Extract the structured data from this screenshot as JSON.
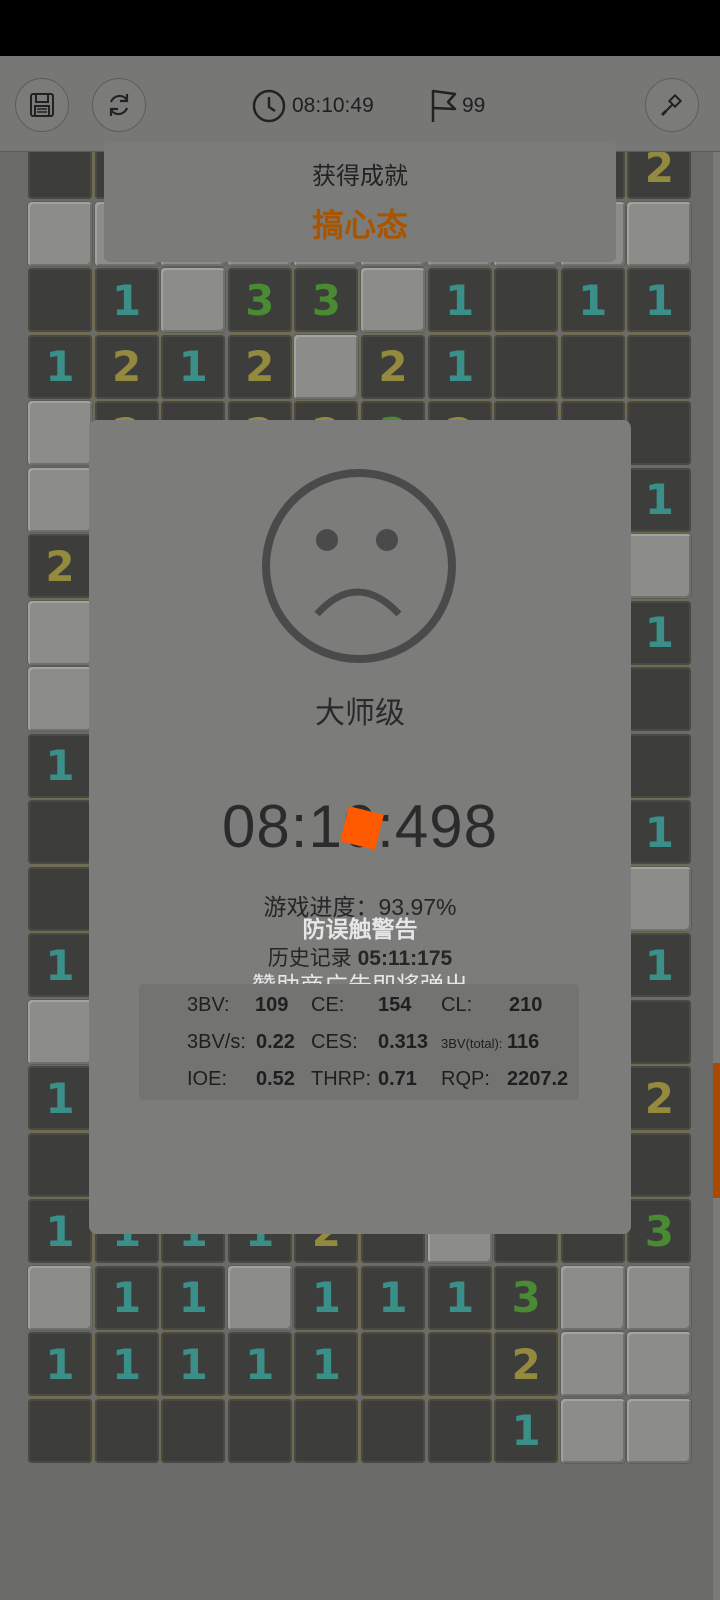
{
  "toolbar": {
    "timer": "08:10:49",
    "flags": "99",
    "icons": [
      "save-icon",
      "restart-icon",
      "clock-icon",
      "flag-icon",
      "shovel-icon"
    ]
  },
  "achievement": {
    "title": "获得成就",
    "name": "搞心态"
  },
  "result": {
    "level": "大师级",
    "time": "08:10:498",
    "progress": "游戏进度：93.97%",
    "record_label": "历史记录",
    "record_value": "05:11:175",
    "warning_title": "防误触警告",
    "warning_sub": "赞助商广告即将弹出",
    "stats": [
      {
        "label": "3BV:",
        "value": "109"
      },
      {
        "label": "CE:",
        "value": "154"
      },
      {
        "label": "CL:",
        "value": "210"
      },
      {
        "label": "3BV/s:",
        "value": "0.22"
      },
      {
        "label": "CES:",
        "value": "0.313"
      },
      {
        "label": "3BV(total):",
        "value": "116"
      },
      {
        "label": "IOE:",
        "value": "0.52"
      },
      {
        "label": "THRP:",
        "value": "0.71"
      },
      {
        "label": "RQP:",
        "value": "2207.2"
      }
    ]
  },
  "board": {
    "rows": [
      "oooooooo o2",
      "ccccccccc c",
      "o1c33c1o11",
      "1212c21ooo",
      "c2o2232ooo",
      "coooooooo1",
      "2ooooooooc",
      "coooooooo1",
      "cooooooooo",
      "1ooooooooo",
      "oooooooo o1",
      "oooooooooc",
      "1oooooooo1",
      "cooooooooo1",
      "1oooooooo2",
      "ooooooooooc",
      "11112ocoo3c*",
      "c11c1113cc",
      "11111oo2cc",
      "ooooooo1cc"
    ]
  }
}
